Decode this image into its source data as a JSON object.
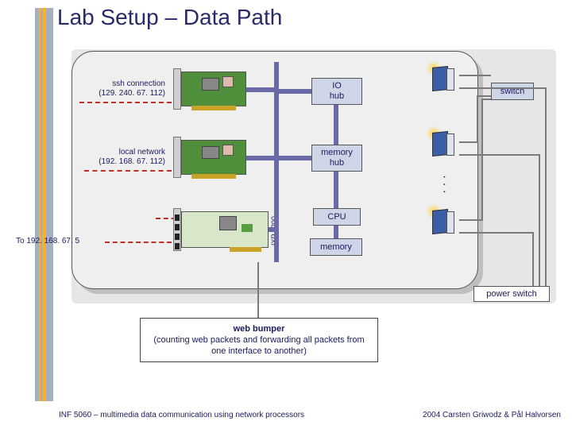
{
  "title": "Lab Setup – Data Path",
  "labels": {
    "ssh": {
      "name": "ssh connection",
      "ip": "(129. 240. 67. 112)"
    },
    "local": {
      "name": "local network",
      "ip": "(192. 168. 67. 112)"
    },
    "to": "To 192. 168. 67. 5"
  },
  "hubs": {
    "io": "IO\nhub",
    "mem": "memory\nhub"
  },
  "blocks": {
    "cpu": "CPU",
    "memory": "memory",
    "switch": "switch",
    "power_switch": "power switch",
    "ixp": "IXP 1200"
  },
  "webbox": {
    "title": "web bumper",
    "body": "(counting web packets and forwarding all packets from one interface to another)"
  },
  "footer": {
    "left": "INF 5060 – multimedia data communication using network processors",
    "right": "2004 Carsten Griwodz & Pål Halvorsen"
  }
}
